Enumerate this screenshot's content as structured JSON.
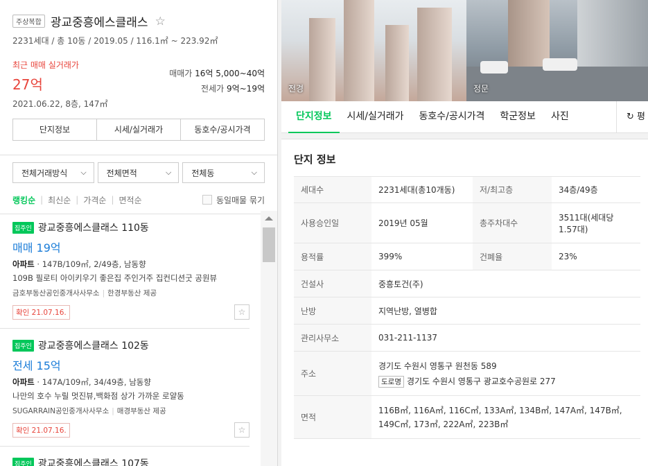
{
  "header": {
    "tag": "주상복합",
    "complex_name": "광교중흥에스클래스",
    "meta": "2231세대 / 총 10동 / 2019.05 / 116.1㎡ ~ 223.92㎡",
    "recent_label": "최근 매매 실거래가",
    "recent_price": "27억",
    "recent_date": "2021.06.22, 8층, 147㎡",
    "sale_label": "매매가",
    "sale_range": "16억 5,000~40억",
    "jeonse_label": "전세가",
    "jeonse_range": "9억~19억"
  },
  "seg_tabs": [
    "단지정보",
    "시세/실거래가",
    "동호수/공시가격"
  ],
  "filters": [
    "전체거래방식",
    "전체면적",
    "전체동"
  ],
  "sort": {
    "options": [
      "랭킹순",
      "최신순",
      "가격순",
      "면적순"
    ],
    "bundle_label": "동일매물 묶기"
  },
  "listings": [
    {
      "badge": "집주인",
      "name": "광교중흥에스클래스 110동",
      "deal": "매매 19억",
      "type": "아파트",
      "spec": "147B/109㎡, 2/49층, 남동향",
      "desc": "109B 필로티 아이키우기 좋은집 주인거주 집컨디션굿 공원뷰",
      "agent": "금호부동산공인중개사사무소",
      "provider": "한경부동산 제공",
      "confirm": "확인 21.07.16."
    },
    {
      "badge": "집주인",
      "name": "광교중흥에스클래스 102동",
      "deal": "전세 15억",
      "type": "아파트",
      "spec": "147A/109㎡, 34/49층, 남동향",
      "desc": "나만의 호수 누릴 멋진뷰,백화점 상가 가까운 로얄동",
      "agent": "SUGARRAIN공인중개사사무소",
      "provider": "매경부동산 제공",
      "confirm": "확인 21.07.16."
    },
    {
      "badge": "집주인",
      "name": "광교중흥에스클래스 107동",
      "deal": "",
      "type": "",
      "spec": "",
      "desc": "",
      "agent": "",
      "provider": "",
      "confirm": ""
    }
  ],
  "photos": {
    "photo1_caption": "전경",
    "photo2_caption": "정문"
  },
  "detail_tabs": [
    "단지정보",
    "시세/실거래가",
    "동호수/공시가격",
    "학군정보",
    "사진"
  ],
  "detail_tab_more": "평",
  "info": {
    "title": "단지 정보",
    "rows": {
      "households_k": "세대수",
      "households_v": "2231세대(총10개동)",
      "floors_k": "저/최고층",
      "floors_v": "34층/49층",
      "approval_k": "사용승인일",
      "approval_v": "2019년 05월",
      "parking_k": "총주차대수",
      "parking_v": "3511대(세대당 1.57대)",
      "far_k": "용적률",
      "far_v": "399%",
      "bcr_k": "건폐율",
      "bcr_v": "23%",
      "builder_k": "건설사",
      "builder_v": "중흥토건(주)",
      "heating_k": "난방",
      "heating_v": "지역난방, 열병합",
      "office_k": "관리사무소",
      "office_v": "031-211-1137",
      "address_k": "주소",
      "address_v": "경기도 수원시 영통구 원천동 589",
      "road_tag": "도로명",
      "road_v": "경기도 수원시 영통구 광교호수공원로 277",
      "area_k": "면적",
      "area_v": "116B㎡, 116A㎡, 116C㎡, 133A㎡, 134B㎡, 147A㎡, 147B㎡, 149C㎡, 173㎡, 222A㎡, 223B㎡"
    }
  }
}
